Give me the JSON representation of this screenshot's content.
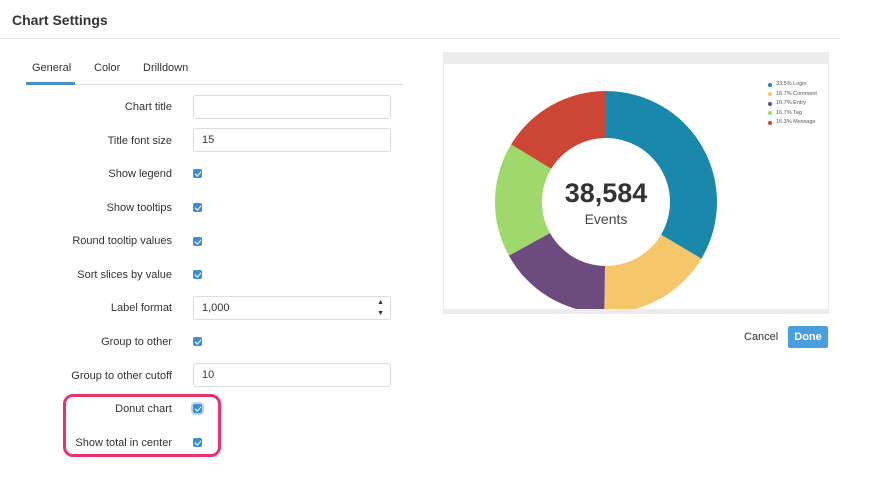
{
  "dialog": {
    "title": "Chart Settings"
  },
  "tabs": [
    {
      "label": "General",
      "active": true
    },
    {
      "label": "Color",
      "active": false
    },
    {
      "label": "Drilldown",
      "active": false
    }
  ],
  "form": {
    "chart_title": {
      "label": "Chart title",
      "value": ""
    },
    "title_font_size": {
      "label": "Title font size",
      "value": "15"
    },
    "show_legend": {
      "label": "Show legend",
      "checked": true
    },
    "show_tooltips": {
      "label": "Show tooltips",
      "checked": true
    },
    "round_tooltip_values": {
      "label": "Round tooltip values",
      "checked": true
    },
    "sort_slices_by_value": {
      "label": "Sort slices by value",
      "checked": true
    },
    "label_format": {
      "label": "Label format",
      "value": "1,000"
    },
    "group_to_other": {
      "label": "Group to other",
      "checked": true
    },
    "group_to_other_cutoff": {
      "label": "Group to other cutoff",
      "value": "10"
    },
    "donut_chart": {
      "label": "Donut chart",
      "checked": true
    },
    "show_total_in_center": {
      "label": "Show total in center",
      "checked": true
    }
  },
  "highlight_color": "#e8336f",
  "accent_color": "#4a9ede",
  "preview": {
    "center_value": "38,584",
    "center_label": "Events"
  },
  "chart_data": {
    "type": "pie",
    "donut": true,
    "total": "38,584",
    "total_label": "Events",
    "legend_position": "top-right",
    "slices": [
      {
        "label": "33.5% Login",
        "percent": 33.5,
        "color": "#1a88aa"
      },
      {
        "label": "16.7% Comment",
        "percent": 16.7,
        "color": "#f5c76a"
      },
      {
        "label": "16.7% Entry",
        "percent": 16.7,
        "color": "#6e4b7e"
      },
      {
        "label": "16.7% Tag",
        "percent": 16.7,
        "color": "#9fd86b"
      },
      {
        "label": "16.3% Message",
        "percent": 16.3,
        "color": "#cc4535"
      }
    ]
  },
  "buttons": {
    "cancel": "Cancel",
    "done": "Done"
  }
}
